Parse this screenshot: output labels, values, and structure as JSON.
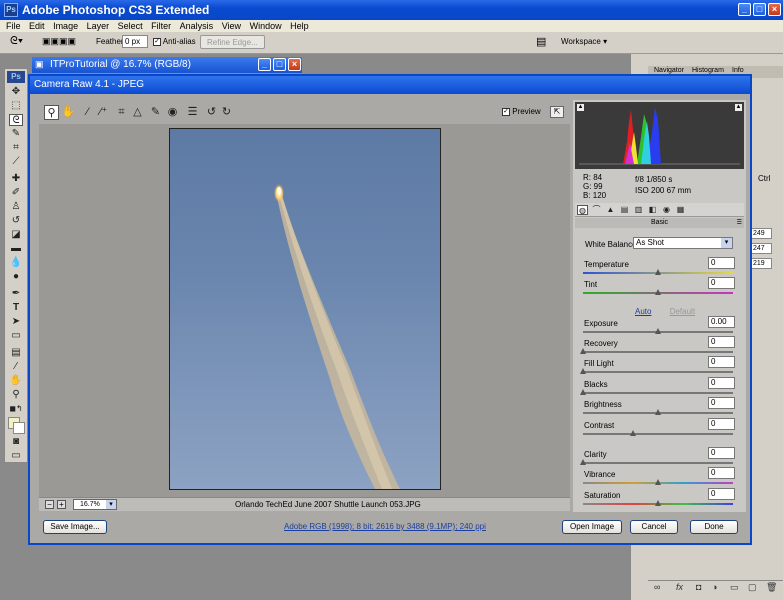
{
  "app": {
    "title": "Adobe Photoshop CS3 Extended",
    "menu": [
      "File",
      "Edit",
      "Image",
      "Layer",
      "Select",
      "Filter",
      "Analysis",
      "View",
      "Window",
      "Help"
    ],
    "options": {
      "feather_label": "Feather:",
      "feather_value": "0 px",
      "antialias_label": "Anti-alias",
      "refine_edge": "Refine Edge...",
      "workspace": "Workspace"
    },
    "toolbox_badge": "Ps"
  },
  "document": {
    "title": "ITProTutorial @ 16.7% (RGB/8)"
  },
  "palettes": {
    "tabs": [
      "Navigator",
      "Histogram",
      "Info"
    ],
    "fields": [
      "249",
      "247",
      "219"
    ],
    "ctrl": "Ctrl"
  },
  "camera_raw": {
    "title": "Camera Raw 4.1  -  JPEG",
    "preview_label": "Preview",
    "zoom": "16.7%",
    "filename": "Orlando TechEd June 2007 Shuttle Launch 053.JPG",
    "readout": {
      "r": "R:   84",
      "g": "G:   99",
      "b": "B:  120",
      "aperture": "f/8    1/850 s",
      "iso": "ISO 200   67 mm"
    },
    "section": "Basic",
    "white_balance_label": "White Balance:",
    "white_balance_value": "As Shot",
    "auto_label": "Auto",
    "default_label": "Default",
    "sliders": [
      {
        "label": "Temperature",
        "value": "0",
        "pos": 0.5
      },
      {
        "label": "Tint",
        "value": "0",
        "pos": 0.5
      },
      {
        "label": "Exposure",
        "value": "0.00",
        "pos": 0.5
      },
      {
        "label": "Recovery",
        "value": "0",
        "pos": 0.0
      },
      {
        "label": "Fill Light",
        "value": "0",
        "pos": 0.0
      },
      {
        "label": "Blacks",
        "value": "0",
        "pos": 0.0
      },
      {
        "label": "Brightness",
        "value": "0",
        "pos": 0.5
      },
      {
        "label": "Contrast",
        "value": "0",
        "pos": 0.33
      },
      {
        "label": "Clarity",
        "value": "0",
        "pos": 0.0
      },
      {
        "label": "Vibrance",
        "value": "0",
        "pos": 0.5
      },
      {
        "label": "Saturation",
        "value": "0",
        "pos": 0.5
      }
    ],
    "buttons": {
      "save": "Save Image...",
      "workflow": "Adobe RGB (1998); 8 bit; 2616 by 3488 (9.1MP); 240 ppi",
      "open": "Open Image",
      "cancel": "Cancel",
      "done": "Done"
    }
  }
}
